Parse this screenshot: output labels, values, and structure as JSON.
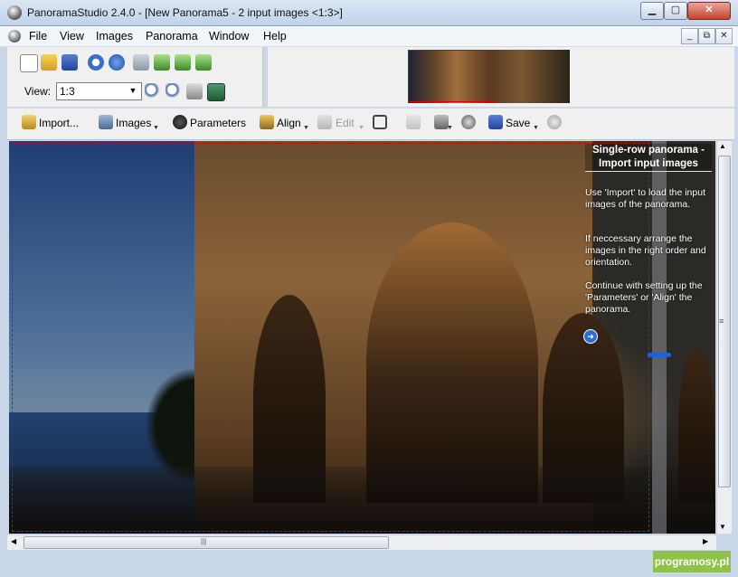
{
  "window": {
    "title": "PanoramaStudio 2.4.0 - [New Panorama5 - 2 input images <1:3>]",
    "controls": {
      "minimize": "▁",
      "maximize": "▢",
      "close": "✕"
    },
    "mdi_controls": {
      "minimize": "_",
      "restore": "⧉",
      "close": "✕"
    }
  },
  "menu": [
    "File",
    "View",
    "Images",
    "Panorama",
    "Window",
    "Help"
  ],
  "view": {
    "label": "View:",
    "zoom_value": "1:3"
  },
  "toolbar": {
    "import": "Import...",
    "images": "Images",
    "parameters": "Parameters",
    "align": "Align",
    "edit": "Edit",
    "save": "Save"
  },
  "help": {
    "title": "Single-row panorama - Import input images",
    "p1": "Use 'Import' to load the input images of the panorama.",
    "p2": "If neccessary arrange the images in the right order and orientation.",
    "p3": "Continue with setting up the 'Parameters' or 'Align' the panorama."
  },
  "hscroll_grip": "|||",
  "watermark": "programosy.pl",
  "colors": {
    "selection": "#e00000",
    "accent": "#1f5fd8",
    "watermark_bg": "#8fc24a"
  }
}
